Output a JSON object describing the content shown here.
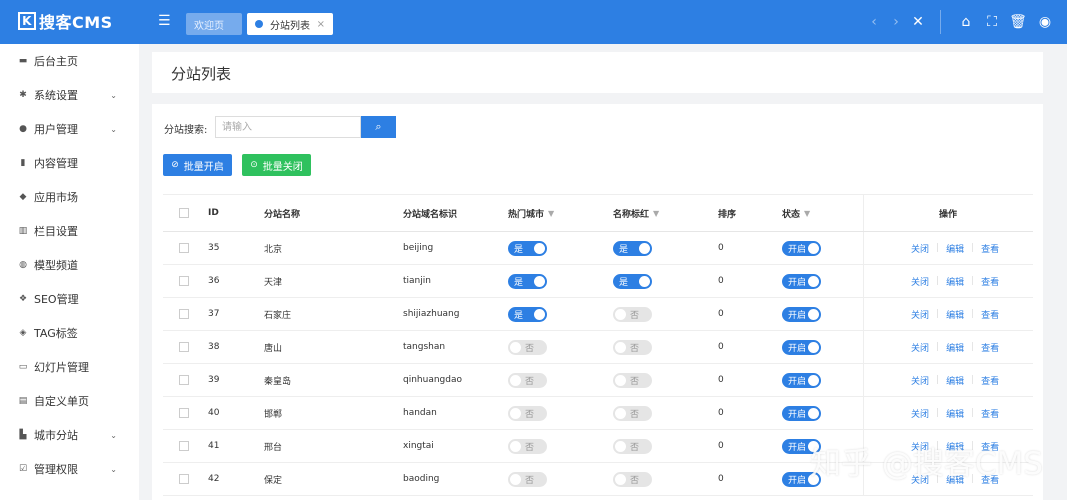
{
  "brand": {
    "logo_text": "搜客CMS"
  },
  "topbar": {
    "tabs": [
      {
        "label": "欢迎页"
      },
      {
        "label": "分站列表",
        "close": "×"
      }
    ]
  },
  "sidebar": {
    "items": [
      {
        "label": "后台主页",
        "icon": "monitor-icon"
      },
      {
        "label": "系统设置",
        "icon": "gear-icon",
        "caret": "chevron-down-icon"
      },
      {
        "label": "用户管理",
        "icon": "user-icon",
        "caret": "chevron-down-icon"
      },
      {
        "label": "内容管理",
        "icon": "document-icon"
      },
      {
        "label": "应用市场",
        "icon": "cube-icon"
      },
      {
        "label": "栏目设置",
        "icon": "columns-icon"
      },
      {
        "label": "模型频道",
        "icon": "globe-icon"
      },
      {
        "label": "SEO管理",
        "icon": "paw-icon"
      },
      {
        "label": "TAG标签",
        "icon": "tag-icon"
      },
      {
        "label": "幻灯片管理",
        "icon": "slides-icon"
      },
      {
        "label": "自定义单页",
        "icon": "page-icon"
      },
      {
        "label": "城市分站",
        "icon": "building-icon",
        "caret": "chevron-down-icon"
      },
      {
        "label": "管理权限",
        "icon": "check-square-icon",
        "caret": "chevron-down-icon"
      }
    ]
  },
  "page": {
    "title": "分站列表"
  },
  "search": {
    "label": "分站搜索:",
    "placeholder": "请输入"
  },
  "bulk": {
    "open_label": "批量开启",
    "close_label": "批量关闭"
  },
  "table": {
    "headers": {
      "id": "ID",
      "name": "分站名称",
      "domain": "分站域名标识",
      "hot": "热门城市",
      "red": "名称标红",
      "order": "排序",
      "status": "状态",
      "ops": "操作"
    },
    "ops": {
      "close": "关闭",
      "edit": "编辑",
      "view": "查看"
    },
    "rows": [
      {
        "id": "35",
        "name": "北京",
        "domain": "beijing",
        "hot": "是",
        "red": "是",
        "order": "0",
        "status": "开启"
      },
      {
        "id": "36",
        "name": "天津",
        "domain": "tianjin",
        "hot": "是",
        "red": "是",
        "order": "0",
        "status": "开启"
      },
      {
        "id": "37",
        "name": "石家庄",
        "domain": "shijiazhuang",
        "hot": "是",
        "red": "否",
        "order": "0",
        "status": "开启"
      },
      {
        "id": "38",
        "name": "唐山",
        "domain": "tangshan",
        "hot": "否",
        "red": "否",
        "order": "0",
        "status": "开启"
      },
      {
        "id": "39",
        "name": "秦皇岛",
        "domain": "qinhuangdao",
        "hot": "否",
        "red": "否",
        "order": "0",
        "status": "开启"
      },
      {
        "id": "40",
        "name": "邯郸",
        "domain": "handan",
        "hot": "否",
        "red": "否",
        "order": "0",
        "status": "开启"
      },
      {
        "id": "41",
        "name": "邢台",
        "domain": "xingtai",
        "hot": "否",
        "red": "否",
        "order": "0",
        "status": "开启"
      },
      {
        "id": "42",
        "name": "保定",
        "domain": "baoding",
        "hot": "否",
        "red": "否",
        "order": "0",
        "status": "开启"
      }
    ]
  },
  "watermark": "知乎 @搜客CMS",
  "colors": {
    "primary": "#2d7fe3",
    "success": "#2fc15e"
  }
}
